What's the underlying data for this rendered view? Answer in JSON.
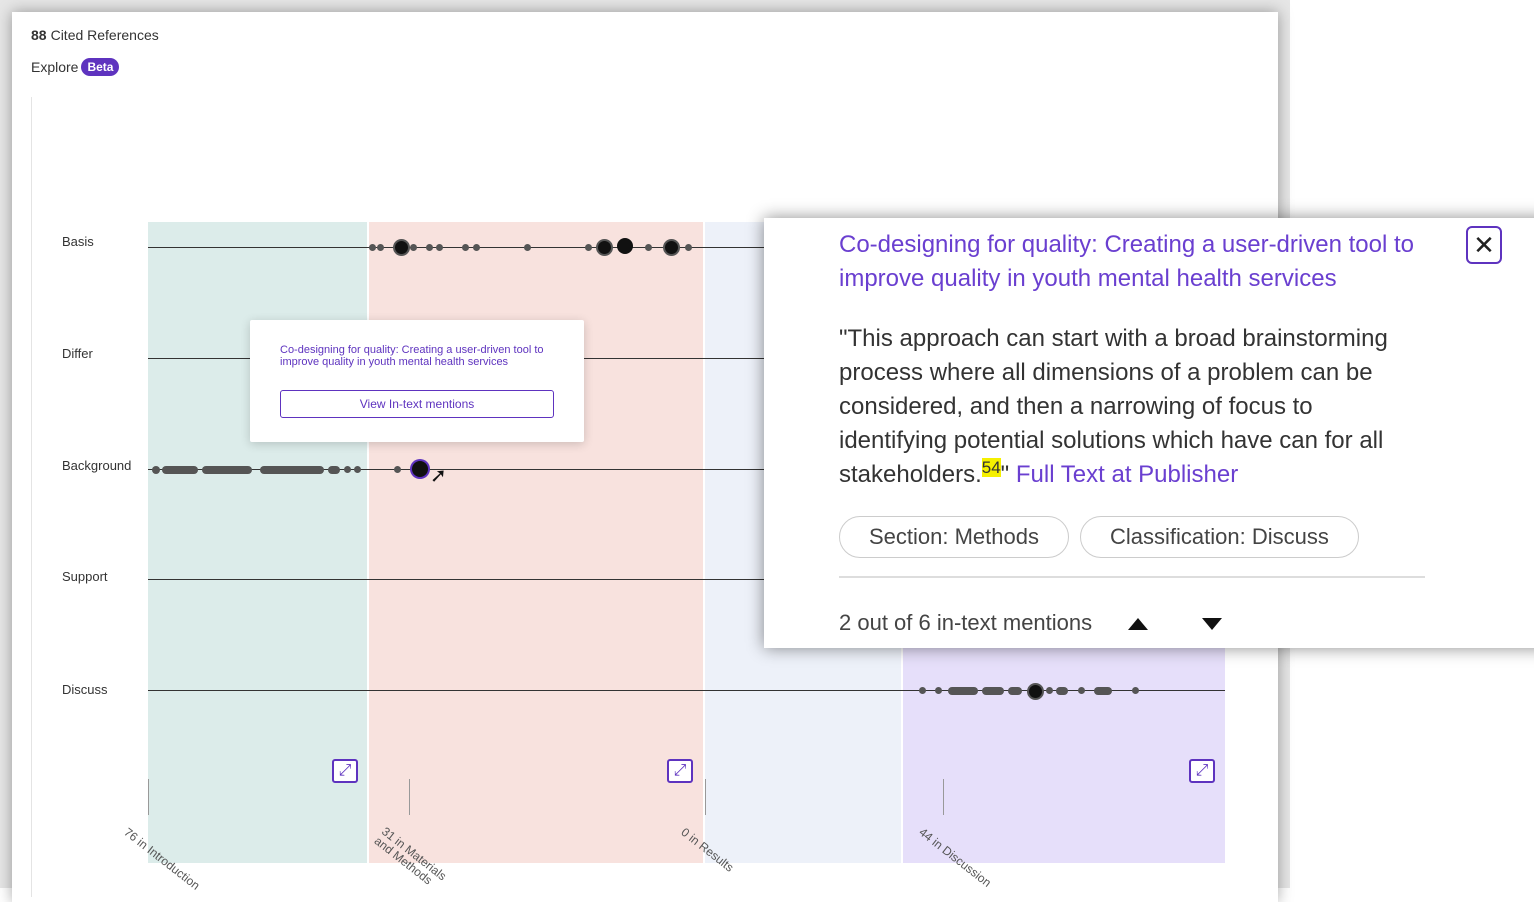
{
  "header": {
    "cited_count": "88",
    "cited_label": "Cited References",
    "explore_label": "Explore",
    "beta_badge": "Beta"
  },
  "rows": [
    {
      "label": "Basis"
    },
    {
      "label": "Differ"
    },
    {
      "label": "Background"
    },
    {
      "label": "Support"
    },
    {
      "label": "Discuss"
    }
  ],
  "sections": [
    {
      "label": "76 in Introduction",
      "color": "#dcecea"
    },
    {
      "label": "31 in Materials and Methods",
      "color": "#f8e2de"
    },
    {
      "label": "0 in Results",
      "color": "#edf1f9"
    },
    {
      "label": "44 in Discussion",
      "color": "#e6dffa"
    }
  ],
  "tooltip": {
    "title": "Co-designing for quality: Creating a user-driven tool to improve quality in youth mental health services",
    "button": "View In-text mentions"
  },
  "popup": {
    "title": "Co-designing for quality: Creating a user-driven tool to improve quality in youth mental health services",
    "quote": "\"This approach can start with a broad brainstorming process where all dimensions of a problem can be considered, and then a narrowing of focus to identifying potential solutions which have can for all stakeholders.",
    "ref_number": "54",
    "quote_end": "\"",
    "full_text_link": "Full Text at Publisher",
    "section_chip": "Section: Methods",
    "classification_chip": "Classification: Discuss",
    "mention_count": "2 out of 6 in-text mentions",
    "close_icon": "close-icon",
    "up_icon": "caret-up-icon",
    "down_icon": "caret-down-icon"
  },
  "colors": {
    "accent": "#5e33bf",
    "highlight": "#f5f000"
  }
}
